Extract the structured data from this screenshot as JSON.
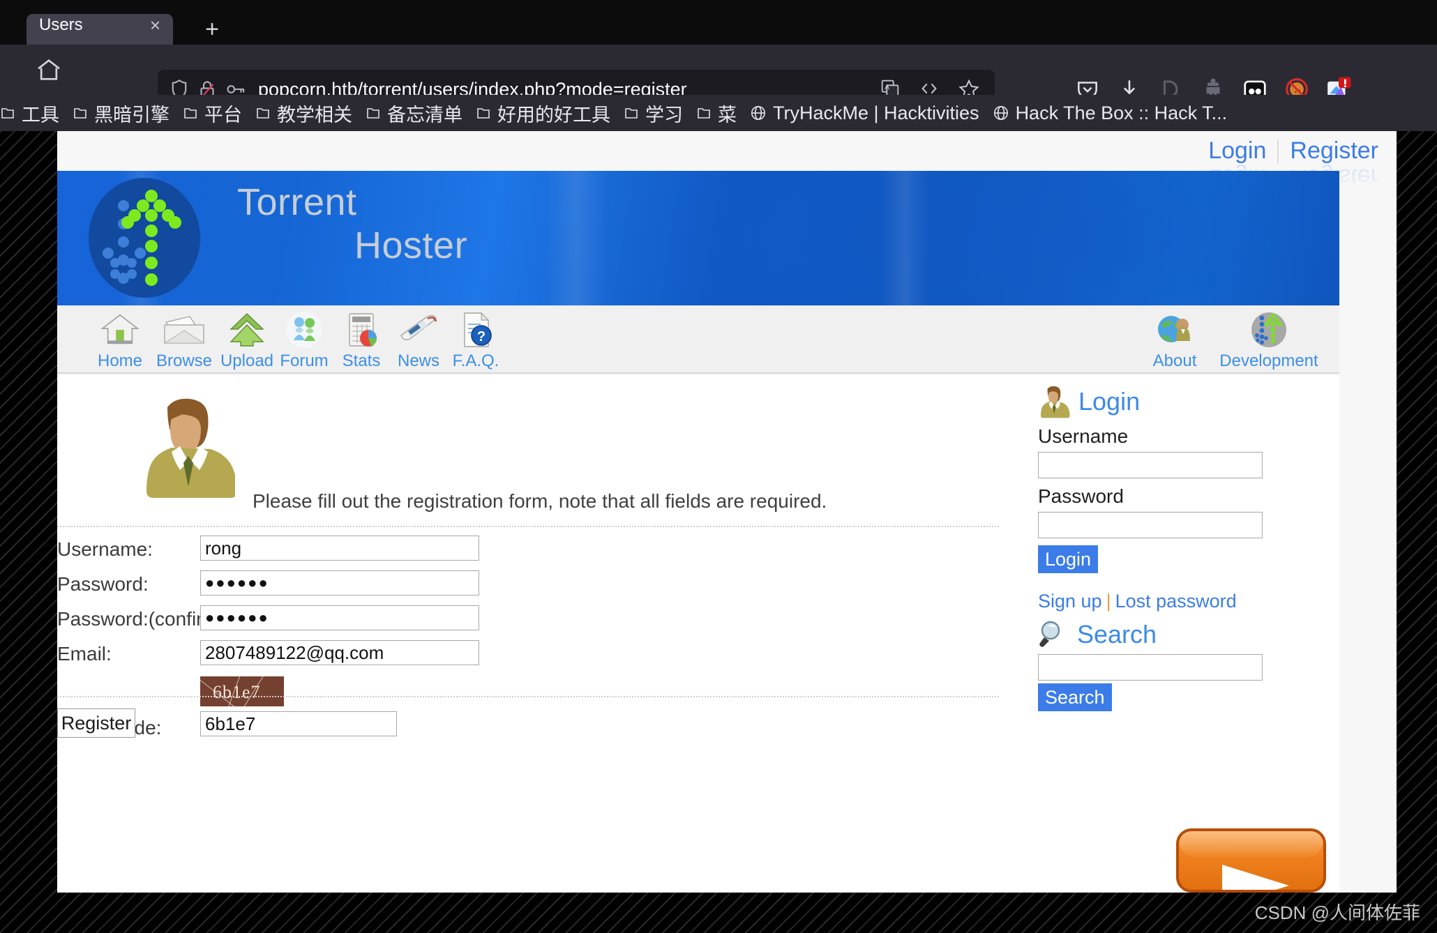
{
  "browser": {
    "tab": {
      "title": "Users",
      "close_label": "×"
    },
    "new_tab_label": "+",
    "url": "popcorn.htb/torrent/users/index.php?mode=register",
    "url_icons": [
      "shield-icon",
      "broken-lock-icon",
      "key-icon"
    ],
    "url_right_icons": [
      "translate-icon",
      "reader-code-icon",
      "bookmark-star-icon"
    ],
    "toolbar_icons": [
      "pocket-icon",
      "downloads-icon",
      "devtools-icon",
      "hacker-extension-icon",
      "oo-extension-icon",
      "blocked-cookie-icon",
      "extension-alert-icon"
    ],
    "bookmarks": [
      {
        "label": "工具",
        "icon": "folder-icon"
      },
      {
        "label": "黑暗引擎",
        "icon": "folder-icon"
      },
      {
        "label": "平台",
        "icon": "folder-icon"
      },
      {
        "label": "教学相关",
        "icon": "folder-icon"
      },
      {
        "label": "备忘清单",
        "icon": "folder-icon"
      },
      {
        "label": "好用的好工具",
        "icon": "folder-icon"
      },
      {
        "label": "学习",
        "icon": "folder-icon"
      },
      {
        "label": "菜",
        "icon": "folder-icon"
      },
      {
        "label": "TryHackMe | Hacktivities",
        "icon": "globe-icon"
      },
      {
        "label": "Hack The Box :: Hack T...",
        "icon": "globe-icon"
      }
    ]
  },
  "site": {
    "topnav": {
      "login": "Login",
      "register": "Register"
    },
    "banner": {
      "word1": "Torrent",
      "word2": "Hoster"
    },
    "nav": [
      {
        "label": "Home",
        "icon": "house-icon"
      },
      {
        "label": "Browse",
        "icon": "folder-open-icon"
      },
      {
        "label": "Upload",
        "icon": "green-up-arrow-icon"
      },
      {
        "label": "Forum",
        "icon": "people-icon"
      },
      {
        "label": "Stats",
        "icon": "chart-calculator-icon"
      },
      {
        "label": "News",
        "icon": "newspaper-icon"
      },
      {
        "label": "F.A.Q.",
        "icon": "document-question-icon"
      }
    ],
    "nav_right": [
      {
        "label": "About",
        "icon": "globe-person-icon"
      },
      {
        "label": "Development",
        "icon": "dev-dots-icon"
      }
    ],
    "main": {
      "avatar_icon": "user-avatar-icon",
      "intro": "Please fill out the registration form, note that all fields are required.",
      "fields": [
        {
          "label": "Username:",
          "value": "rong",
          "type": "text",
          "name": "username-field"
        },
        {
          "label": "Password:",
          "value": "●●●●●●",
          "type": "password",
          "name": "password-field"
        },
        {
          "label": "Password:(confirm)",
          "value": "●●●●●●",
          "type": "password",
          "name": "password-confirm-field"
        },
        {
          "label": "Email:",
          "value": "2807489122@qq.com",
          "type": "text",
          "name": "email-field"
        }
      ],
      "captcha": {
        "label": "Enter Code:",
        "image_text": "6b1e7",
        "value": "6b1e7"
      },
      "submit_label": "Register"
    },
    "sidebar": {
      "login": {
        "title": "Login",
        "icon": "user-avatar-icon",
        "username_label": "Username",
        "username_value": "",
        "password_label": "Password",
        "password_value": "",
        "button_label": "Login"
      },
      "links": {
        "signup": "Sign up",
        "separator": "|",
        "lost_password": "Lost password"
      },
      "search": {
        "title": "Search",
        "icon": "magnifier-icon",
        "value": "",
        "button_label": "Search"
      },
      "rss_button_icon": "orange-play-button"
    }
  },
  "watermark": "CSDN @人间体佐菲",
  "colors": {
    "link_blue": "#3b7ce8",
    "banner_blue": "#1565d4",
    "accent_orange": "#ef7f1d",
    "chrome_bg": "#2b2a33"
  }
}
